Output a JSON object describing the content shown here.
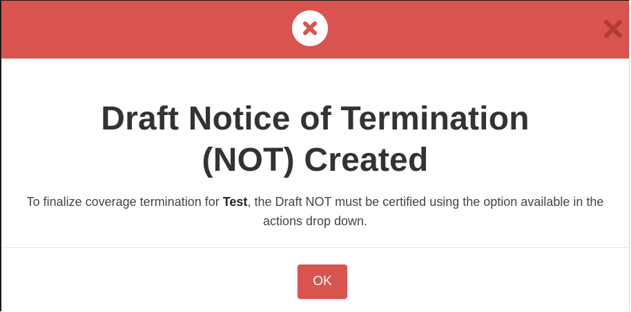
{
  "dialog": {
    "header": {
      "status_icon": "error-circle-x-icon",
      "close_icon": "close-x-icon",
      "color": "#d9534f"
    },
    "title_line_1": "Draft Notice of Termination",
    "title_line_2": "(NOT) Created",
    "message_before": "To finalize coverage termination for ",
    "message_bold": "Test",
    "message_after": ", the Draft NOT must be certified using the option available in the actions drop down.",
    "ok_label": "OK"
  }
}
